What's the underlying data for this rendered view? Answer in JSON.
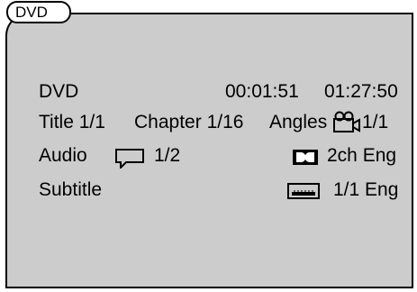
{
  "tab_label": "DVD",
  "info": {
    "source": "DVD",
    "elapsed": "00:01:51",
    "total": "01:27:50"
  },
  "title": {
    "label": "Title",
    "value": "1/1"
  },
  "chapter": {
    "label": "Chapter",
    "value": "1/16"
  },
  "angles": {
    "label": "Angles",
    "value": "1/1"
  },
  "audio": {
    "label": "Audio",
    "value": "1/2",
    "format": "2ch Eng"
  },
  "subtitle": {
    "label": "Subtitle",
    "value": "1/1 Eng"
  },
  "icons": {
    "angles": "camera-icon",
    "audio": "speech-bubble-icon",
    "format": "dolby-icon",
    "subtitle": "subtitle-icon"
  }
}
